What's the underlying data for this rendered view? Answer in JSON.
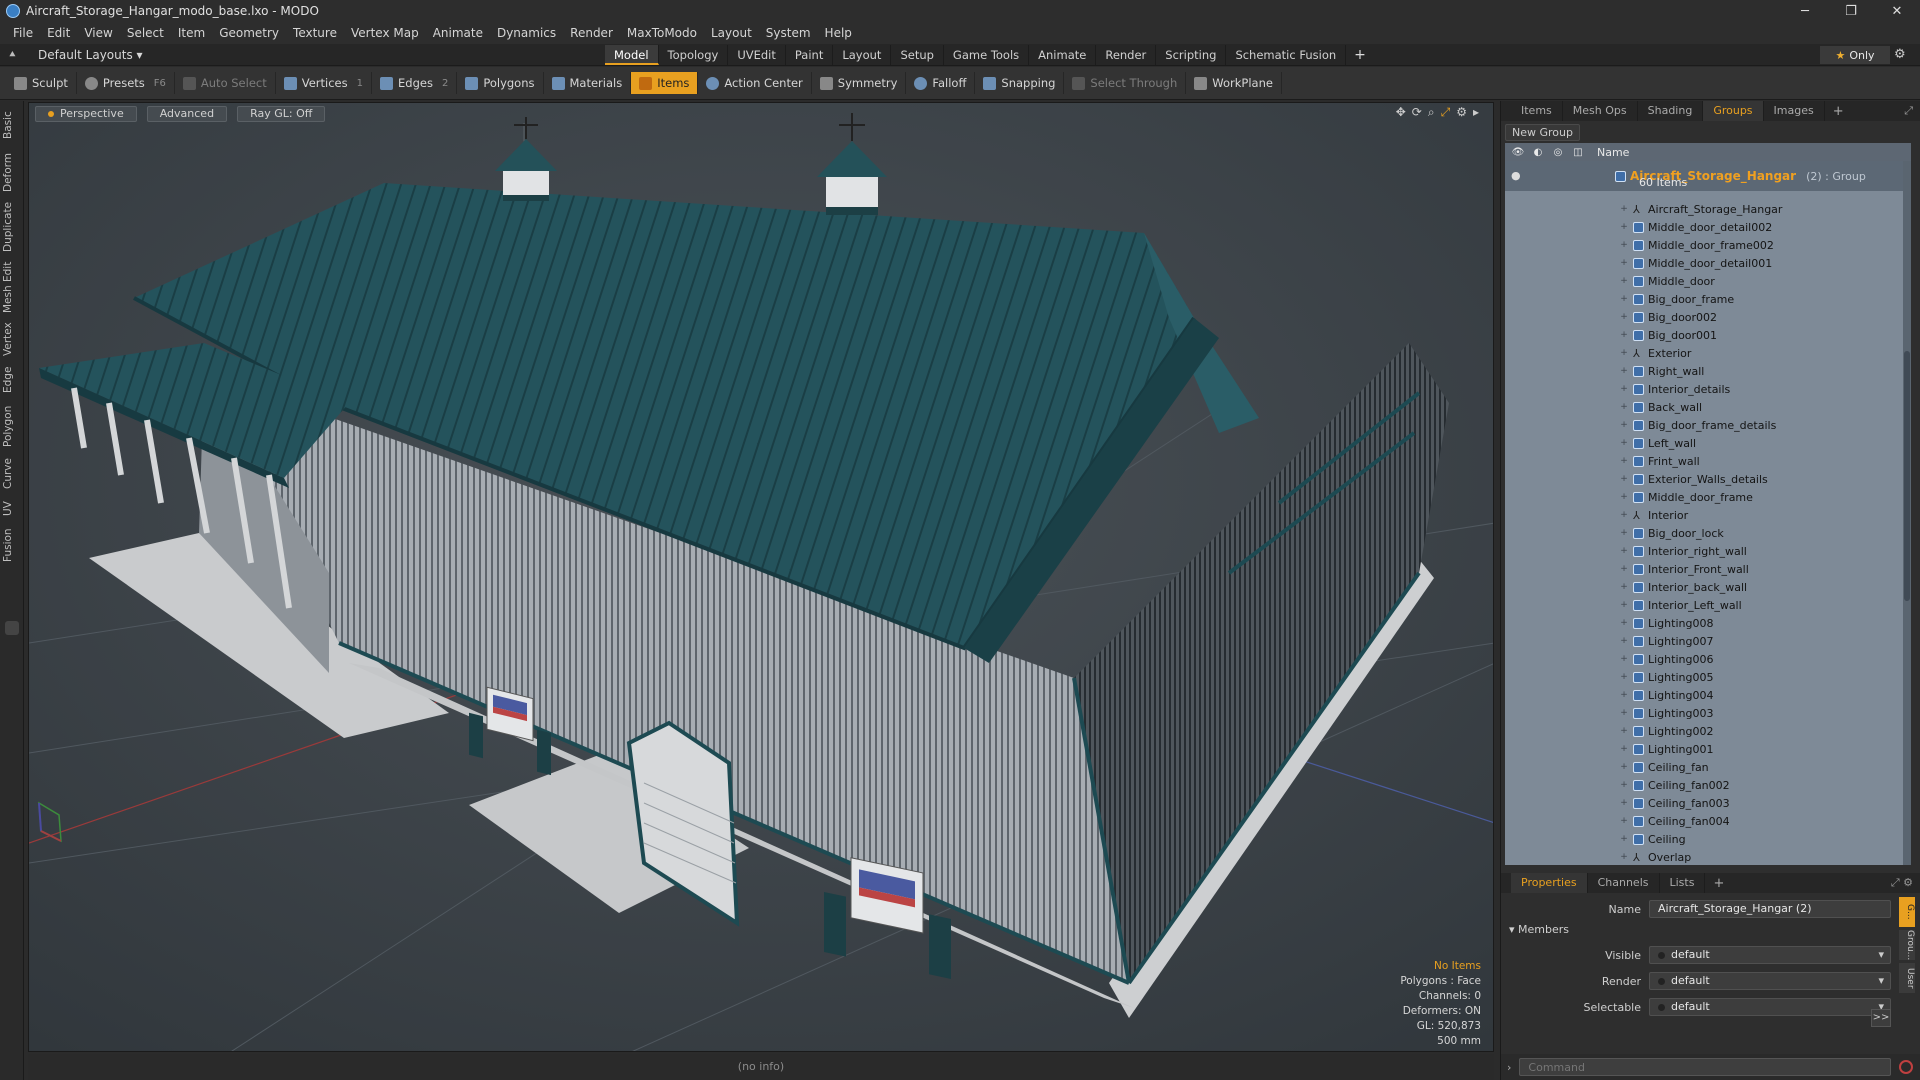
{
  "window": {
    "title": "Aircraft_Storage_Hangar_modo_base.lxo - MODO",
    "controls": {
      "minimize": "─",
      "maximize": "❐",
      "close": "✕"
    }
  },
  "menu": [
    "File",
    "Edit",
    "View",
    "Select",
    "Item",
    "Geometry",
    "Texture",
    "Vertex Map",
    "Animate",
    "Dynamics",
    "Render",
    "MaxToModo",
    "Layout",
    "System",
    "Help"
  ],
  "layout_selector": "Default Layouts ▾",
  "tabs": [
    "Model",
    "Topology",
    "UVEdit",
    "Paint",
    "Layout",
    "Setup",
    "Game Tools",
    "Animate",
    "Render",
    "Scripting",
    "Schematic Fusion"
  ],
  "active_tab": "Model",
  "tab_add": "+",
  "only_label": "Only",
  "toolbar": {
    "sculpt": "Sculpt",
    "presets": "Presets",
    "presets_key": "F6",
    "auto_select": "Auto Select",
    "vertices": "Vertices",
    "vertices_key": "1",
    "edges": "Edges",
    "edges_key": "2",
    "polygons": "Polygons",
    "materials": "Materials",
    "items": "Items",
    "action_center": "Action Center",
    "symmetry": "Symmetry",
    "falloff": "Falloff",
    "snapping": "Snapping",
    "select_through": "Select Through",
    "workplane": "WorkPlane"
  },
  "left_tabs": [
    "Basic",
    "Deform",
    "Duplicate",
    "Mesh Edit",
    "Vertex",
    "Edge",
    "Polygon",
    "Curve",
    "UV",
    "Fusion"
  ],
  "viewport": {
    "perspective": "Perspective",
    "advanced": "Advanced",
    "raygl": "Ray GL: Off",
    "info": {
      "no_items": "No Items",
      "polygons": "Polygons : Face",
      "channels": "Channels: 0",
      "deformers": "Deformers: ON",
      "gl": "GL: 520,873",
      "scale": "500 mm"
    }
  },
  "status": "(no info)",
  "panel_tabs": [
    "Items",
    "Mesh Ops",
    "Shading",
    "Groups",
    "Images"
  ],
  "active_panel_tab": "Groups",
  "new_group": "New Group",
  "tree_header_name": "Name",
  "group": {
    "name": "Aircraft_Storage_Hangar",
    "meta": "(2) : Group",
    "count": "60 Items"
  },
  "items": [
    {
      "name": "Aircraft_Storage_Hangar",
      "type": "locator"
    },
    {
      "name": "Middle_door_detail002",
      "type": "mesh"
    },
    {
      "name": "Middle_door_frame002",
      "type": "mesh"
    },
    {
      "name": "Middle_door_detail001",
      "type": "mesh"
    },
    {
      "name": "Middle_door",
      "type": "mesh"
    },
    {
      "name": "Big_door_frame",
      "type": "mesh"
    },
    {
      "name": "Big_door002",
      "type": "mesh"
    },
    {
      "name": "Big_door001",
      "type": "mesh"
    },
    {
      "name": "Exterior",
      "type": "locator"
    },
    {
      "name": "Right_wall",
      "type": "mesh"
    },
    {
      "name": "Interior_details",
      "type": "mesh"
    },
    {
      "name": "Back_wall",
      "type": "mesh"
    },
    {
      "name": "Big_door_frame_details",
      "type": "mesh"
    },
    {
      "name": "Left_wall",
      "type": "mesh"
    },
    {
      "name": "Frint_wall",
      "type": "mesh"
    },
    {
      "name": "Exterior_Walls_details",
      "type": "mesh"
    },
    {
      "name": "Middle_door_frame",
      "type": "mesh"
    },
    {
      "name": "Interior",
      "type": "locator"
    },
    {
      "name": "Big_door_lock",
      "type": "mesh"
    },
    {
      "name": "Interior_right_wall",
      "type": "mesh"
    },
    {
      "name": "Interior_Front_wall",
      "type": "mesh"
    },
    {
      "name": "Interior_back_wall",
      "type": "mesh"
    },
    {
      "name": "Interior_Left_wall",
      "type": "mesh"
    },
    {
      "name": "Lighting008",
      "type": "mesh"
    },
    {
      "name": "Lighting007",
      "type": "mesh"
    },
    {
      "name": "Lighting006",
      "type": "mesh"
    },
    {
      "name": "Lighting005",
      "type": "mesh"
    },
    {
      "name": "Lighting004",
      "type": "mesh"
    },
    {
      "name": "Lighting003",
      "type": "mesh"
    },
    {
      "name": "Lighting002",
      "type": "mesh"
    },
    {
      "name": "Lighting001",
      "type": "mesh"
    },
    {
      "name": "Ceiling_fan",
      "type": "mesh"
    },
    {
      "name": "Ceiling_fan002",
      "type": "mesh"
    },
    {
      "name": "Ceiling_fan003",
      "type": "mesh"
    },
    {
      "name": "Ceiling_fan004",
      "type": "mesh"
    },
    {
      "name": "Ceiling",
      "type": "mesh"
    },
    {
      "name": "Overlap",
      "type": "locator"
    }
  ],
  "props_tabs": [
    "Properties",
    "Channels",
    "Lists"
  ],
  "active_props_tab": "Properties",
  "properties": {
    "name_label": "Name",
    "name_value": "Aircraft_Storage_Hangar (2)",
    "members": "Members",
    "visible_label": "Visible",
    "visible_value": "default",
    "render_label": "Render",
    "render_value": "default",
    "selectable_label": "Selectable",
    "selectable_value": "default",
    "more": ">>"
  },
  "side_tabs": [
    "G...",
    "Grou...",
    "User"
  ],
  "command_placeholder": "Command",
  "colors": {
    "accent": "#e8a020",
    "roof": "#234a52",
    "wall": "#9aa0a6",
    "viewport_bg": "#3c4247"
  }
}
